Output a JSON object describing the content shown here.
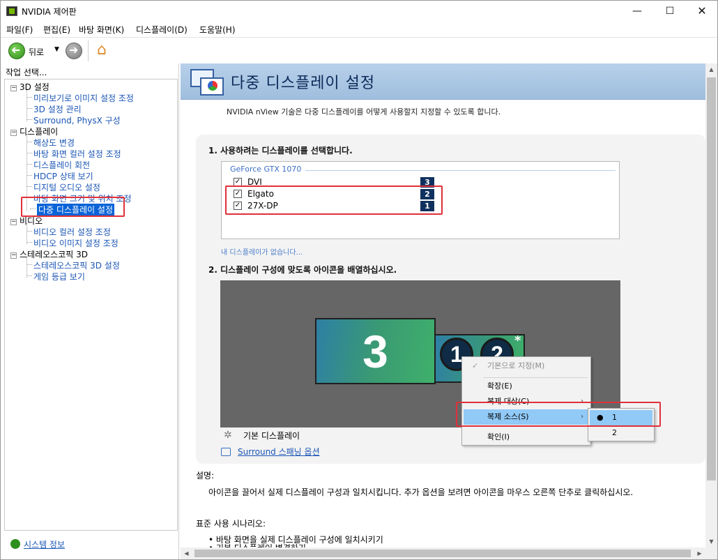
{
  "window": {
    "title": "NVIDIA 제어판",
    "minimize": "—",
    "maximize": "☐",
    "close": "✕"
  },
  "menu": [
    "파일(F)",
    "편집(E)",
    "바탕 화면(K)",
    "디스플레이(D)",
    "도움말(H)"
  ],
  "toolbar": {
    "back_label": "뒤로",
    "dropdown": "▼",
    "home_icon": "⌂"
  },
  "left": {
    "header": "작업 선택...",
    "tree": [
      {
        "label": "3D 설정",
        "children": [
          "미리보기로 이미지 설정 조정",
          "3D 설정 관리",
          "Surround, PhysX 구성"
        ]
      },
      {
        "label": "디스플레이",
        "children": [
          "해상도 변경",
          "바탕 화면 컬러 설정 조정",
          "디스플레이 회전",
          "HDCP 상태 보기",
          "디지털 오디오 설정",
          "바탕 화면 크기 및 위치 조정",
          "다중 디스플레이 설정"
        ]
      },
      {
        "label": "비디오",
        "children": [
          "비디오 컬러 설정 조정",
          "비디오 이미지 설정 조정"
        ]
      },
      {
        "label": "스테레오스코픽 3D",
        "children": [
          "스테레오스코픽 3D 설정",
          "게임 등급 보기"
        ]
      }
    ],
    "selected": "다중 디스플레이 설정",
    "system_info": "시스템 정보"
  },
  "main": {
    "title": "다중 디스플레이 설정",
    "intro": "NVIDIA nView 기술은 다중 디스플레이를 어떻게 사용할지 지정할 수 있도록 합니다.",
    "step1": "1. 사용하려는 디스플레이를 선택합니다.",
    "gpu": "GeForce GTX 1070",
    "displays": [
      {
        "name": "DVI",
        "checked": true,
        "number": "3"
      },
      {
        "name": "Elgato",
        "checked": true,
        "number": "2"
      },
      {
        "name": "27X-DP",
        "checked": true,
        "number": "1"
      }
    ],
    "check_glyph": "✓",
    "no_display_link": "내 디스플레이가 없습니다...",
    "step2": "2. 디스플레이 구성에 맞도록 아이콘을 배열하십시오.",
    "monitors": {
      "big": "3",
      "small_a": "1",
      "small_b": "2",
      "asterisk": "*"
    },
    "legend": "기본 디스플레이",
    "legend_icon": "✲",
    "surround_link": "Surround 스패닝 옵션",
    "desc_label": "설명:",
    "desc_text": "아이콘을 끌어서 실제 디스플레이 구성과 일치시킵니다. 추가 옵션을 보려면 아이콘을 마우스 오른쪽 단추로 클릭하십시오.",
    "usage_label": "표준 사용 시나리오:",
    "usage": [
      "• 바탕 화면을 실제 디스플레이 구성에 일치시키기",
      "• 기본 디스플레이 변경하기"
    ]
  },
  "context_menu": {
    "items": [
      {
        "label": "기본으로 지정(M)",
        "disabled": true,
        "check": "✓"
      },
      {
        "label": "확장(E)"
      },
      {
        "label": "복제 대상(C)",
        "submenu": true
      },
      {
        "label": "복제 소스(S)",
        "submenu": true,
        "highlighted": true
      },
      {
        "label": "확인(I)"
      }
    ],
    "submenu_arrow": "›",
    "submenu": [
      {
        "label": "1",
        "selected": true
      },
      {
        "label": "2"
      }
    ],
    "bullet": "●"
  },
  "scroll": {
    "up": "▲",
    "down": "▼",
    "left": "◀",
    "right": "▶"
  }
}
